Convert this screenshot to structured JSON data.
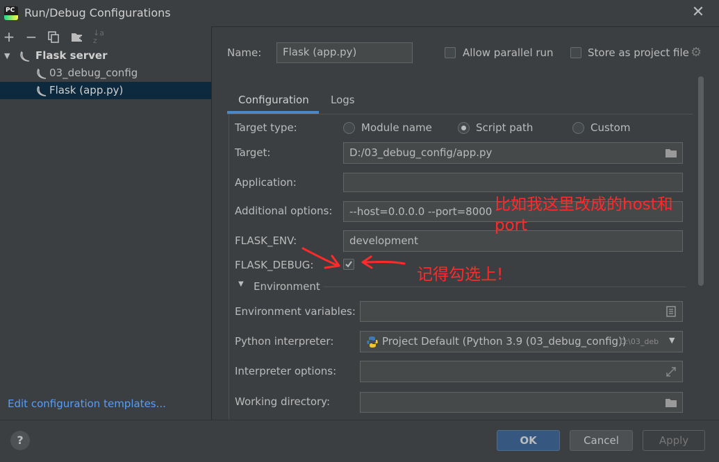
{
  "window": {
    "title": "Run/Debug Configurations",
    "app_icon_text": "PC"
  },
  "toolbar": {
    "add": "+",
    "remove": "−",
    "sort": "↓a z"
  },
  "tree": {
    "group_label": "Flask server",
    "items": [
      {
        "label": "03_debug_config"
      },
      {
        "label": "Flask (app.py)"
      }
    ]
  },
  "left_footer": {
    "edit_templates": "Edit configuration templates..."
  },
  "header": {
    "name_label": "Name:",
    "name_value": "Flask (app.py)",
    "allow_parallel": "Allow parallel run",
    "store_as_project": "Store as project file"
  },
  "tabs": [
    {
      "label": "Configuration"
    },
    {
      "label": "Logs"
    }
  ],
  "config": {
    "target_type_label": "Target type:",
    "target_type_options": [
      "Module name",
      "Script path",
      "Custom"
    ],
    "target_type_selected": "Script path",
    "target_label": "Target:",
    "target_value": "D:/03_debug_config/app.py",
    "application_label": "Application:",
    "application_value": "",
    "additional_options_label": "Additional options:",
    "additional_options_value": "--host=0.0.0.0 --port=8000",
    "flask_env_label": "FLASK_ENV:",
    "flask_env_value": "development",
    "flask_debug_label": "FLASK_DEBUG:",
    "flask_debug_checked": true,
    "environment_section": "Environment",
    "env_vars_label": "Environment variables:",
    "interpreter_label": "Python interpreter:",
    "interpreter_value": "Project Default (Python 3.9 (03_debug_config))",
    "interpreter_path": "D:\\03_deb",
    "interpreter_options_label": "Interpreter options:",
    "working_dir_label": "Working directory:"
  },
  "annotations": {
    "note1_line1": "比如我这里改成的host和",
    "note1_line2": "port",
    "note2": "记得勾选上!"
  },
  "buttons": {
    "help": "?",
    "ok": "OK",
    "cancel": "Cancel",
    "apply": "Apply"
  },
  "colors": {
    "background": "#3c3f41",
    "selection": "#0d293e",
    "link": "#589df6",
    "accent": "#4a88c7",
    "annotation": "#ff2a2a"
  }
}
